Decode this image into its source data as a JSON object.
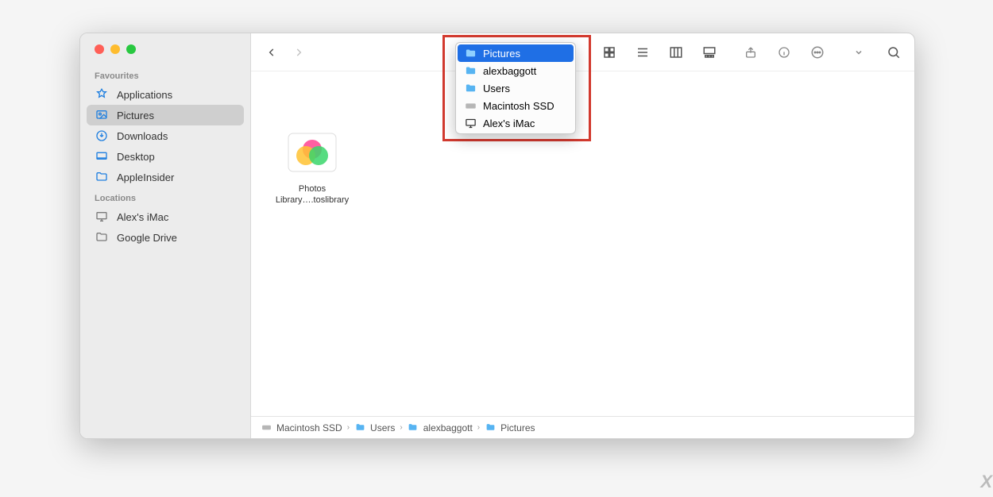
{
  "sidebar": {
    "favourites_label": "Favourites",
    "locations_label": "Locations",
    "favourites": [
      {
        "label": "Applications",
        "icon": "app",
        "selected": false
      },
      {
        "label": "Pictures",
        "icon": "image",
        "selected": true
      },
      {
        "label": "Downloads",
        "icon": "download",
        "selected": false
      },
      {
        "label": "Desktop",
        "icon": "desktop",
        "selected": false
      },
      {
        "label": "AppleInsider",
        "icon": "folder",
        "selected": false
      }
    ],
    "locations": [
      {
        "label": "Alex's iMac",
        "icon": "imac"
      },
      {
        "label": "Google Drive",
        "icon": "folder-outline"
      }
    ]
  },
  "popover": {
    "items": [
      {
        "label": "Pictures",
        "icon": "folder-blue",
        "selected": true
      },
      {
        "label": "alexbaggott",
        "icon": "folder-blue",
        "selected": false
      },
      {
        "label": "Users",
        "icon": "folder-blue",
        "selected": false
      },
      {
        "label": "Macintosh SSD",
        "icon": "disk",
        "selected": false
      },
      {
        "label": "Alex's iMac",
        "icon": "imac",
        "selected": false
      }
    ]
  },
  "content": {
    "file_label_line1": "Photos",
    "file_label_line2": "Library….toslibrary"
  },
  "pathbar": {
    "crumbs": [
      {
        "label": "Macintosh SSD",
        "icon": "disk"
      },
      {
        "label": "Users",
        "icon": "folder-blue"
      },
      {
        "label": "alexbaggott",
        "icon": "folder-blue"
      },
      {
        "label": "Pictures",
        "icon": "folder-blue"
      }
    ]
  },
  "watermark": "X"
}
